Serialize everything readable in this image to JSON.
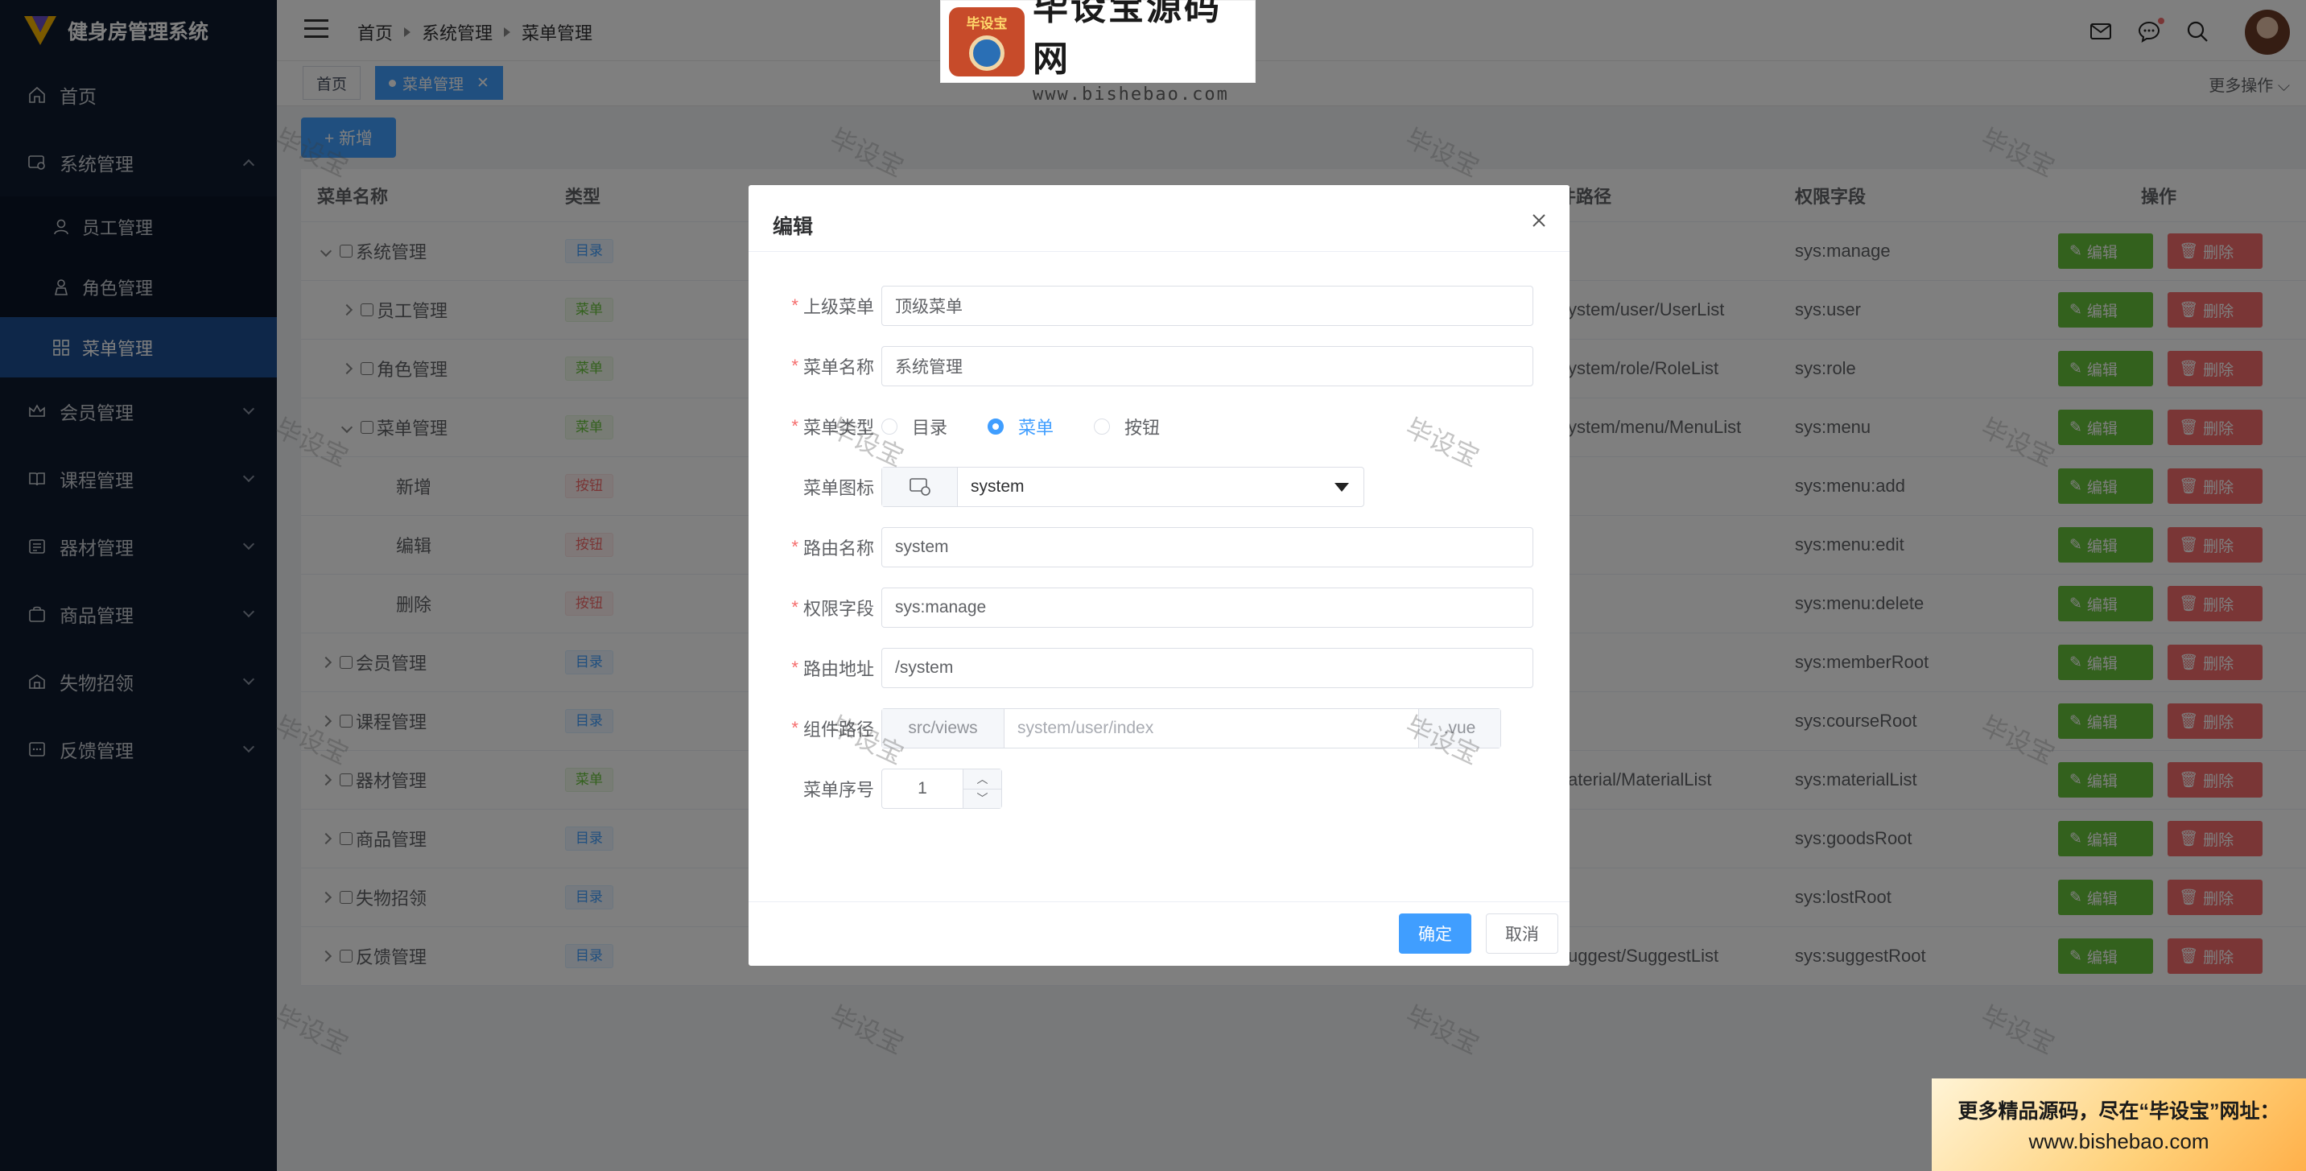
{
  "app": {
    "title": "健身房管理系统"
  },
  "sidebar": {
    "items": [
      {
        "label": "首页",
        "icon": "home-icon"
      },
      {
        "label": "系统管理",
        "icon": "system-icon",
        "expanded": true,
        "children": [
          {
            "label": "员工管理",
            "icon": "user-icon"
          },
          {
            "label": "角色管理",
            "icon": "role-icon"
          },
          {
            "label": "菜单管理",
            "icon": "menu-grid-icon",
            "active": true
          }
        ]
      },
      {
        "label": "会员管理",
        "icon": "crown-icon"
      },
      {
        "label": "课程管理",
        "icon": "book-icon"
      },
      {
        "label": "器材管理",
        "icon": "equipment-icon"
      },
      {
        "label": "商品管理",
        "icon": "goods-icon"
      },
      {
        "label": "失物招领",
        "icon": "lost-icon"
      },
      {
        "label": "反馈管理",
        "icon": "feedback-icon"
      }
    ]
  },
  "header": {
    "breadcrumb": [
      "首页",
      "系统管理",
      "菜单管理"
    ],
    "icons": [
      "mail-icon",
      "message-icon",
      "search-icon"
    ]
  },
  "tags": {
    "items": [
      "首页",
      "菜单管理"
    ],
    "more": "更多操作"
  },
  "toolbar": {
    "add_label": "+ 新增"
  },
  "table": {
    "headers": {
      "name": "菜单名称",
      "type": "类型",
      "component": "组件路径",
      "perm": "权限字段",
      "ops": "操作"
    },
    "edit_label": "编辑",
    "delete_label": "删除",
    "rows": [
      {
        "name": "系统管理",
        "type": "目录",
        "component": "",
        "perm": "sys:manage"
      },
      {
        "name": "员工管理",
        "type": "菜单",
        "component": "ystem/user/UserList",
        "perm": "sys:user"
      },
      {
        "name": "角色管理",
        "type": "菜单",
        "component": "ystem/role/RoleList",
        "perm": "sys:role"
      },
      {
        "name": "菜单管理",
        "type": "菜单",
        "component": "ystem/menu/MenuList",
        "perm": "sys:menu"
      },
      {
        "name": "新增",
        "type": "按钮",
        "component": "",
        "perm": "sys:menu:add"
      },
      {
        "name": "编辑",
        "type": "按钮",
        "component": "",
        "perm": "sys:menu:edit"
      },
      {
        "name": "删除",
        "type": "按钮",
        "component": "",
        "perm": "sys:menu:delete"
      },
      {
        "name": "会员管理",
        "type": "目录",
        "component": "",
        "perm": "sys:memberRoot"
      },
      {
        "name": "课程管理",
        "type": "目录",
        "component": "",
        "perm": "sys:courseRoot"
      },
      {
        "name": "器材管理",
        "type": "菜单",
        "component": "aterial/MaterialList",
        "perm": "sys:materialList"
      },
      {
        "name": "商品管理",
        "type": "目录",
        "component": "",
        "perm": "sys:goodsRoot"
      },
      {
        "name": "失物招领",
        "type": "目录",
        "component": "",
        "perm": "sys:lostRoot"
      },
      {
        "name": "反馈管理",
        "type": "目录",
        "component": "uggest/SuggestList",
        "perm": "sys:suggestRoot"
      }
    ]
  },
  "modal": {
    "title": "编辑",
    "fields": {
      "parent": {
        "label": "上级菜单",
        "value": "顶级菜单"
      },
      "name": {
        "label": "菜单名称",
        "value": "系统管理"
      },
      "type": {
        "label": "菜单类型",
        "options": [
          "目录",
          "菜单",
          "按钮"
        ],
        "selected": "菜单"
      },
      "icon": {
        "label": "菜单图标",
        "value": "system"
      },
      "route_name": {
        "label": "路由名称",
        "value": "system"
      },
      "perm": {
        "label": "权限字段",
        "value": "sys:manage"
      },
      "route_path": {
        "label": "路由地址",
        "value": "/system"
      },
      "component": {
        "label": "组件路径",
        "prefix": "src/views",
        "placeholder": "system/user/index",
        "suffix": ".vue"
      },
      "order": {
        "label": "菜单序号",
        "value": "1"
      }
    },
    "ok_label": "确定",
    "cancel_label": "取消"
  },
  "watermark": {
    "text": "毕设宝"
  },
  "banner": {
    "logo_text": "毕设宝",
    "title": "毕设宝源码网",
    "url": "www.bishebao.com"
  },
  "promo": {
    "line1": "更多精品源码，尽在“毕设宝”网址：",
    "line2": "www.bishebao.com"
  },
  "colors": {
    "primary": "#409eff",
    "sidebar": "#0e1a2f",
    "active_menu": "#1c4f92",
    "success": "#67c23a",
    "danger": "#f56c6c"
  }
}
